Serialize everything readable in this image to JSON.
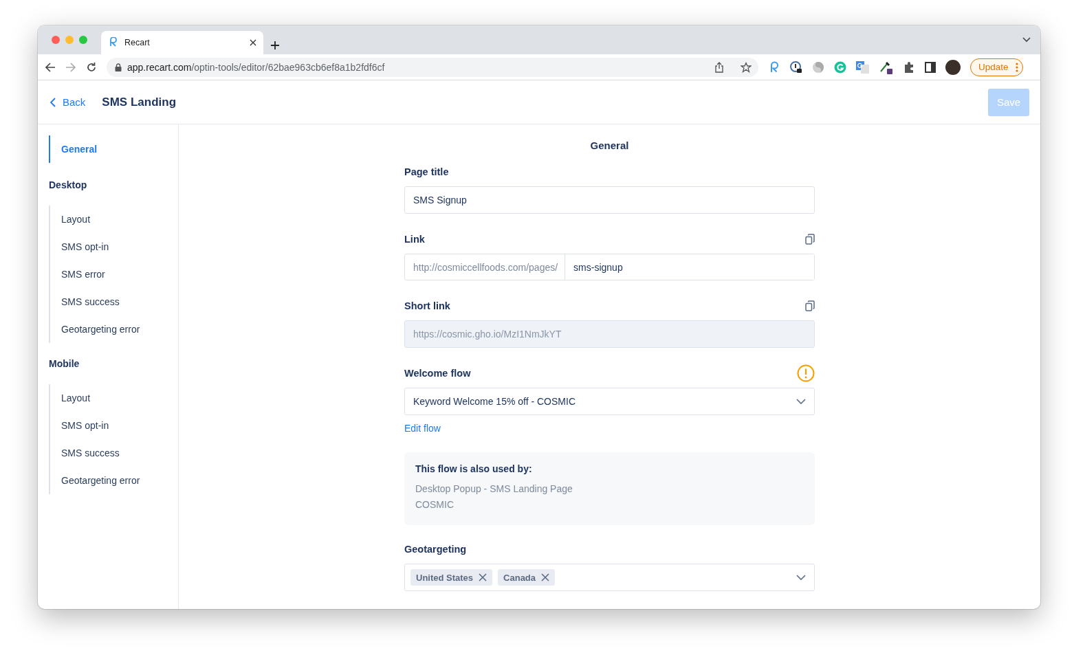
{
  "browser": {
    "tab_title": "Recart",
    "url_host": "app.recart.com",
    "url_path": "/optin-tools/editor/62bae963cb6ef8a1b2fdf6cf",
    "update_button": "Update"
  },
  "header": {
    "back": "Back",
    "title": "SMS Landing",
    "save": {
      "label": "Save",
      "disabled": true
    }
  },
  "sidebar": {
    "top_item": {
      "label": "General",
      "selected": true
    },
    "sections": [
      {
        "title": "Desktop",
        "items": [
          {
            "label": "Layout",
            "selected": false
          },
          {
            "label": "SMS opt-in",
            "selected": false
          },
          {
            "label": "SMS error",
            "selected": false
          },
          {
            "label": "SMS success",
            "selected": false
          },
          {
            "label": "Geotargeting error",
            "selected": false
          }
        ]
      },
      {
        "title": "Mobile",
        "items": [
          {
            "label": "Layout",
            "selected": false
          },
          {
            "label": "SMS opt-in",
            "selected": false
          },
          {
            "label": "SMS success",
            "selected": false
          },
          {
            "label": "Geotargeting error",
            "selected": false
          }
        ]
      }
    ]
  },
  "form": {
    "heading": "General",
    "page_title": {
      "label": "Page title",
      "value": "SMS Signup"
    },
    "link": {
      "label": "Link",
      "prefix": "http://cosmiccellfoods.com/pages/",
      "value": "sms-signup"
    },
    "short_link": {
      "label": "Short link",
      "value": "https://cosmic.gho.io/MzI1NmJkYT",
      "disabled": true
    },
    "welcome_flow": {
      "label": "Welcome flow",
      "value": "Keyword Welcome 15% off - COSMIC",
      "warning": true,
      "edit_link": "Edit flow"
    },
    "usage_note": {
      "title": "This flow is also used by:",
      "lines": [
        "Desktop Popup - SMS Landing Page",
        "COSMIC"
      ]
    },
    "geotargeting": {
      "label": "Geotargeting",
      "tags": [
        "United States",
        "Canada"
      ]
    }
  }
}
